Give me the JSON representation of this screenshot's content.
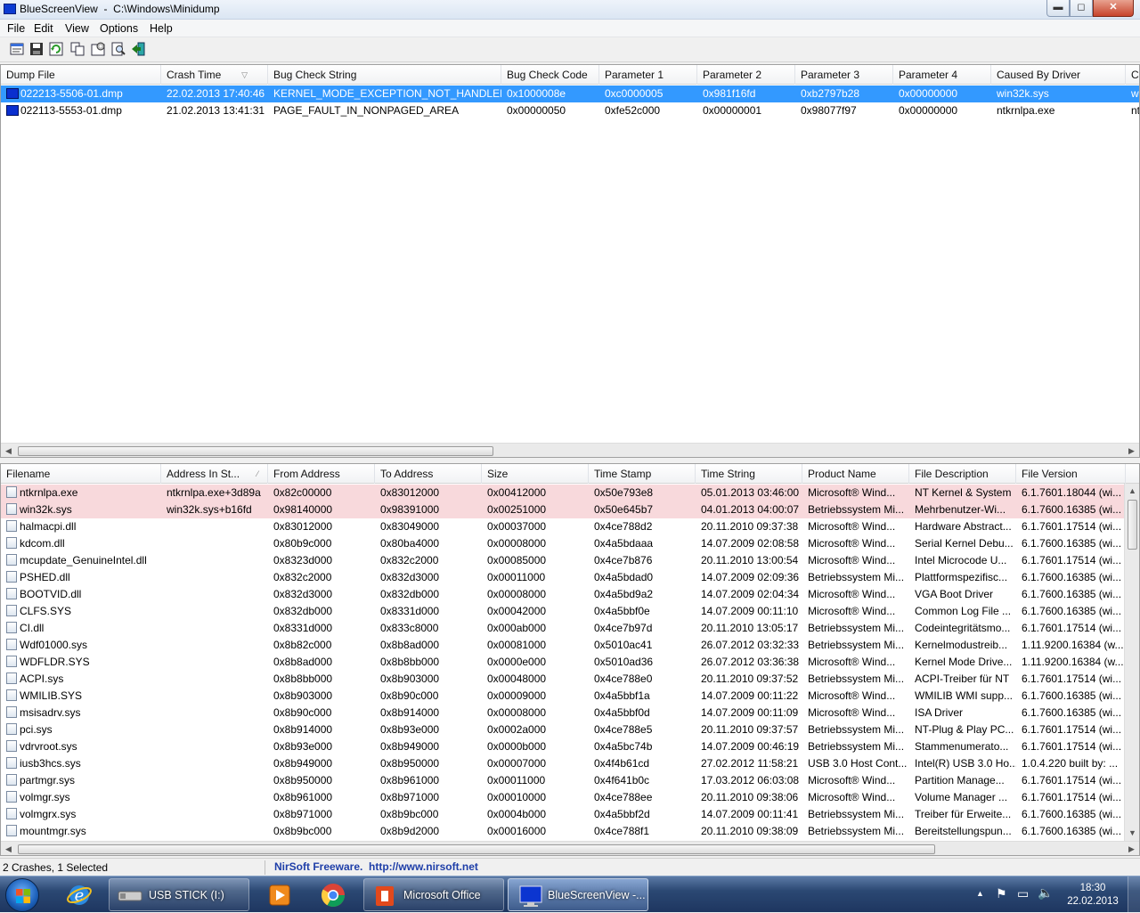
{
  "window": {
    "title": "BlueScreenView  -  C:\\Windows\\Minidump",
    "min_glyph": "▬",
    "max_glyph": "◻",
    "close_glyph": "✕"
  },
  "menu": [
    "File",
    "Edit",
    "View",
    "Options",
    "Help"
  ],
  "toolbar_icons": [
    "properties-icon",
    "save-icon",
    "refresh-icon",
    "copy-icon",
    "advanced-options-icon",
    "find-icon",
    "exit-icon"
  ],
  "crashes": {
    "columns": [
      "Dump File",
      "Crash Time",
      "Bug Check String",
      "Bug Check Code",
      "Parameter 1",
      "Parameter 2",
      "Parameter 3",
      "Parameter 4",
      "Caused By Driver",
      "C"
    ],
    "sort_glyph": "▽",
    "rows": [
      [
        "022213-5506-01.dmp",
        "22.02.2013 17:40:46",
        "KERNEL_MODE_EXCEPTION_NOT_HANDLED",
        "0x1000008e",
        "0xc0000005",
        "0x981f16fd",
        "0xb2797b28",
        "0x00000000",
        "win32k.sys",
        "w"
      ],
      [
        "022113-5553-01.dmp",
        "21.02.2013 13:41:31",
        "PAGE_FAULT_IN_NONPAGED_AREA",
        "0x00000050",
        "0xfe52c000",
        "0x00000001",
        "0x98077f97",
        "0x00000000",
        "ntkrnlpa.exe",
        "nt"
      ]
    ],
    "selected_row": 0
  },
  "drivers": {
    "columns": [
      "Filename",
      "Address In St...",
      "From Address",
      "To Address",
      "Size",
      "Time Stamp",
      "Time String",
      "Product Name",
      "File Description",
      "File Version"
    ],
    "sort_glyph": "⁄",
    "rows": [
      [
        "ntkrnlpa.exe",
        "ntkrnlpa.exe+3d89a",
        "0x82c00000",
        "0x83012000",
        "0x00412000",
        "0x50e793e8",
        "05.01.2013 03:46:00",
        "Microsoft® Wind...",
        "NT Kernel & System",
        "6.1.7601.18044 (wi..."
      ],
      [
        "win32k.sys",
        "win32k.sys+b16fd",
        "0x98140000",
        "0x98391000",
        "0x00251000",
        "0x50e645b7",
        "04.01.2013 04:00:07",
        "Betriebssystem Mi...",
        "Mehrbenutzer-Wi...",
        "6.1.7600.16385 (wi..."
      ],
      [
        "halmacpi.dll",
        "",
        "0x83012000",
        "0x83049000",
        "0x00037000",
        "0x4ce788d2",
        "20.11.2010 09:37:38",
        "Microsoft® Wind...",
        "Hardware Abstract...",
        "6.1.7601.17514 (wi..."
      ],
      [
        "kdcom.dll",
        "",
        "0x80b9c000",
        "0x80ba4000",
        "0x00008000",
        "0x4a5bdaaa",
        "14.07.2009 02:08:58",
        "Microsoft® Wind...",
        "Serial Kernel Debu...",
        "6.1.7600.16385 (wi..."
      ],
      [
        "mcupdate_GenuineIntel.dll",
        "",
        "0x8323d000",
        "0x832c2000",
        "0x00085000",
        "0x4ce7b876",
        "20.11.2010 13:00:54",
        "Microsoft® Wind...",
        "Intel Microcode U...",
        "6.1.7601.17514 (wi..."
      ],
      [
        "PSHED.dll",
        "",
        "0x832c2000",
        "0x832d3000",
        "0x00011000",
        "0x4a5bdad0",
        "14.07.2009 02:09:36",
        "Betriebssystem Mi...",
        "Plattformspezifisc...",
        "6.1.7600.16385 (wi..."
      ],
      [
        "BOOTVID.dll",
        "",
        "0x832d3000",
        "0x832db000",
        "0x00008000",
        "0x4a5bd9a2",
        "14.07.2009 02:04:34",
        "Microsoft® Wind...",
        "VGA Boot Driver",
        "6.1.7600.16385 (wi..."
      ],
      [
        "CLFS.SYS",
        "",
        "0x832db000",
        "0x8331d000",
        "0x00042000",
        "0x4a5bbf0e",
        "14.07.2009 00:11:10",
        "Microsoft® Wind...",
        "Common Log File ...",
        "6.1.7600.16385 (wi..."
      ],
      [
        "CI.dll",
        "",
        "0x8331d000",
        "0x833c8000",
        "0x000ab000",
        "0x4ce7b97d",
        "20.11.2010 13:05:17",
        "Betriebssystem Mi...",
        "Codeintegritätsmo...",
        "6.1.7601.17514 (wi..."
      ],
      [
        "Wdf01000.sys",
        "",
        "0x8b82c000",
        "0x8b8ad000",
        "0x00081000",
        "0x5010ac41",
        "26.07.2012 03:32:33",
        "Betriebssystem Mi...",
        "Kernelmodustreib...",
        "1.11.9200.16384 (w..."
      ],
      [
        "WDFLDR.SYS",
        "",
        "0x8b8ad000",
        "0x8b8bb000",
        "0x0000e000",
        "0x5010ad36",
        "26.07.2012 03:36:38",
        "Microsoft® Wind...",
        "Kernel Mode Drive...",
        "1.11.9200.16384 (w..."
      ],
      [
        "ACPI.sys",
        "",
        "0x8b8bb000",
        "0x8b903000",
        "0x00048000",
        "0x4ce788e0",
        "20.11.2010 09:37:52",
        "Betriebssystem Mi...",
        "ACPI-Treiber für NT",
        "6.1.7601.17514 (wi..."
      ],
      [
        "WMILIB.SYS",
        "",
        "0x8b903000",
        "0x8b90c000",
        "0x00009000",
        "0x4a5bbf1a",
        "14.07.2009 00:11:22",
        "Microsoft® Wind...",
        "WMILIB WMI supp...",
        "6.1.7600.16385 (wi..."
      ],
      [
        "msisadrv.sys",
        "",
        "0x8b90c000",
        "0x8b914000",
        "0x00008000",
        "0x4a5bbf0d",
        "14.07.2009 00:11:09",
        "Microsoft® Wind...",
        "ISA Driver",
        "6.1.7600.16385 (wi..."
      ],
      [
        "pci.sys",
        "",
        "0x8b914000",
        "0x8b93e000",
        "0x0002a000",
        "0x4ce788e5",
        "20.11.2010 09:37:57",
        "Betriebssystem Mi...",
        "NT-Plug & Play PC...",
        "6.1.7601.17514 (wi..."
      ],
      [
        "vdrvroot.sys",
        "",
        "0x8b93e000",
        "0x8b949000",
        "0x0000b000",
        "0x4a5bc74b",
        "14.07.2009 00:46:19",
        "Betriebssystem Mi...",
        "Stammenumerato...",
        "6.1.7601.17514 (wi..."
      ],
      [
        "iusb3hcs.sys",
        "",
        "0x8b949000",
        "0x8b950000",
        "0x00007000",
        "0x4f4b61cd",
        "27.02.2012 11:58:21",
        "USB 3.0 Host Cont...",
        "Intel(R) USB 3.0 Ho...",
        "1.0.4.220 built by: ..."
      ],
      [
        "partmgr.sys",
        "",
        "0x8b950000",
        "0x8b961000",
        "0x00011000",
        "0x4f641b0c",
        "17.03.2012 06:03:08",
        "Microsoft® Wind...",
        "Partition Manage...",
        "6.1.7601.17514 (wi..."
      ],
      [
        "volmgr.sys",
        "",
        "0x8b961000",
        "0x8b971000",
        "0x00010000",
        "0x4ce788ee",
        "20.11.2010 09:38:06",
        "Microsoft® Wind...",
        "Volume Manager ...",
        "6.1.7601.17514 (wi..."
      ],
      [
        "volmgrx.sys",
        "",
        "0x8b971000",
        "0x8b9bc000",
        "0x0004b000",
        "0x4a5bbf2d",
        "14.07.2009 00:11:41",
        "Betriebssystem Mi...",
        "Treiber für Erweite...",
        "6.1.7600.16385 (wi..."
      ],
      [
        "mountmgr.sys",
        "",
        "0x8b9bc000",
        "0x8b9d2000",
        "0x00016000",
        "0x4ce788f1",
        "20.11.2010 09:38:09",
        "Betriebssystem Mi...",
        "Bereitstellungspun...",
        "6.1.7600.16385 (wi..."
      ]
    ],
    "highlighted_rows": [
      0,
      1
    ]
  },
  "scroll_glyphs": {
    "left": "◀",
    "right": "▶",
    "up": "▲",
    "down": "▼",
    "grip": "|||"
  },
  "statusbar": {
    "count": "2 Crashes, 1 Selected",
    "nirsoft": "NirSoft Freeware.  http://www.nirsoft.net"
  },
  "taskbar": {
    "items": [
      {
        "label": "",
        "icon": "internet-explorer-icon"
      },
      {
        "label": "USB STICK (I:)",
        "icon": "usb-drive-icon"
      },
      {
        "label": "",
        "icon": "media-player-icon"
      },
      {
        "label": "",
        "icon": "chrome-icon"
      },
      {
        "label": "Microsoft Office",
        "icon": "office-icon"
      },
      {
        "label": "BlueScreenView -...",
        "icon": "bluescreenview-icon"
      }
    ],
    "tray_glyphs": {
      "show_hidden": "▲",
      "flag": "⚑",
      "network": "▭",
      "volume": "🔈"
    },
    "time": "18:30",
    "date": "22.02.2013"
  },
  "colors": {
    "selection": "#3399ff",
    "highlight_row": "#f8d9dc",
    "nirsoft_link": "#1e3ea8"
  }
}
